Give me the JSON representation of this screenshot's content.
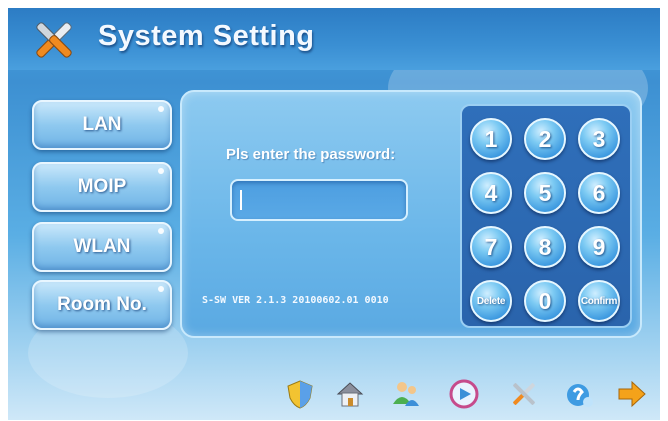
{
  "header": {
    "title": "System  Setting",
    "icon": "tools-icon"
  },
  "menu": {
    "items": [
      {
        "label": "LAN"
      },
      {
        "label": "MOIP"
      },
      {
        "label": "WLAN"
      },
      {
        "label": "Room No."
      }
    ]
  },
  "login": {
    "prompt": "Pls enter the password:",
    "password_value": "",
    "version": "S-SW VER 2.1.3 20100602.01 0010"
  },
  "keypad": {
    "keys": [
      "1",
      "2",
      "3",
      "4",
      "5",
      "6",
      "7",
      "8",
      "9",
      "Delete",
      "0",
      "Confirm"
    ]
  },
  "taskbar": {
    "icons": [
      "shield-icon",
      "home-icon",
      "people-icon",
      "media-icon",
      "tools-icon",
      "support-icon",
      "arrow-right-icon"
    ]
  },
  "colors": {
    "background": "#4aa3de",
    "panel": "#6ab6e9",
    "keypad": "#2f6fba",
    "arrow": "#f4a21a"
  }
}
